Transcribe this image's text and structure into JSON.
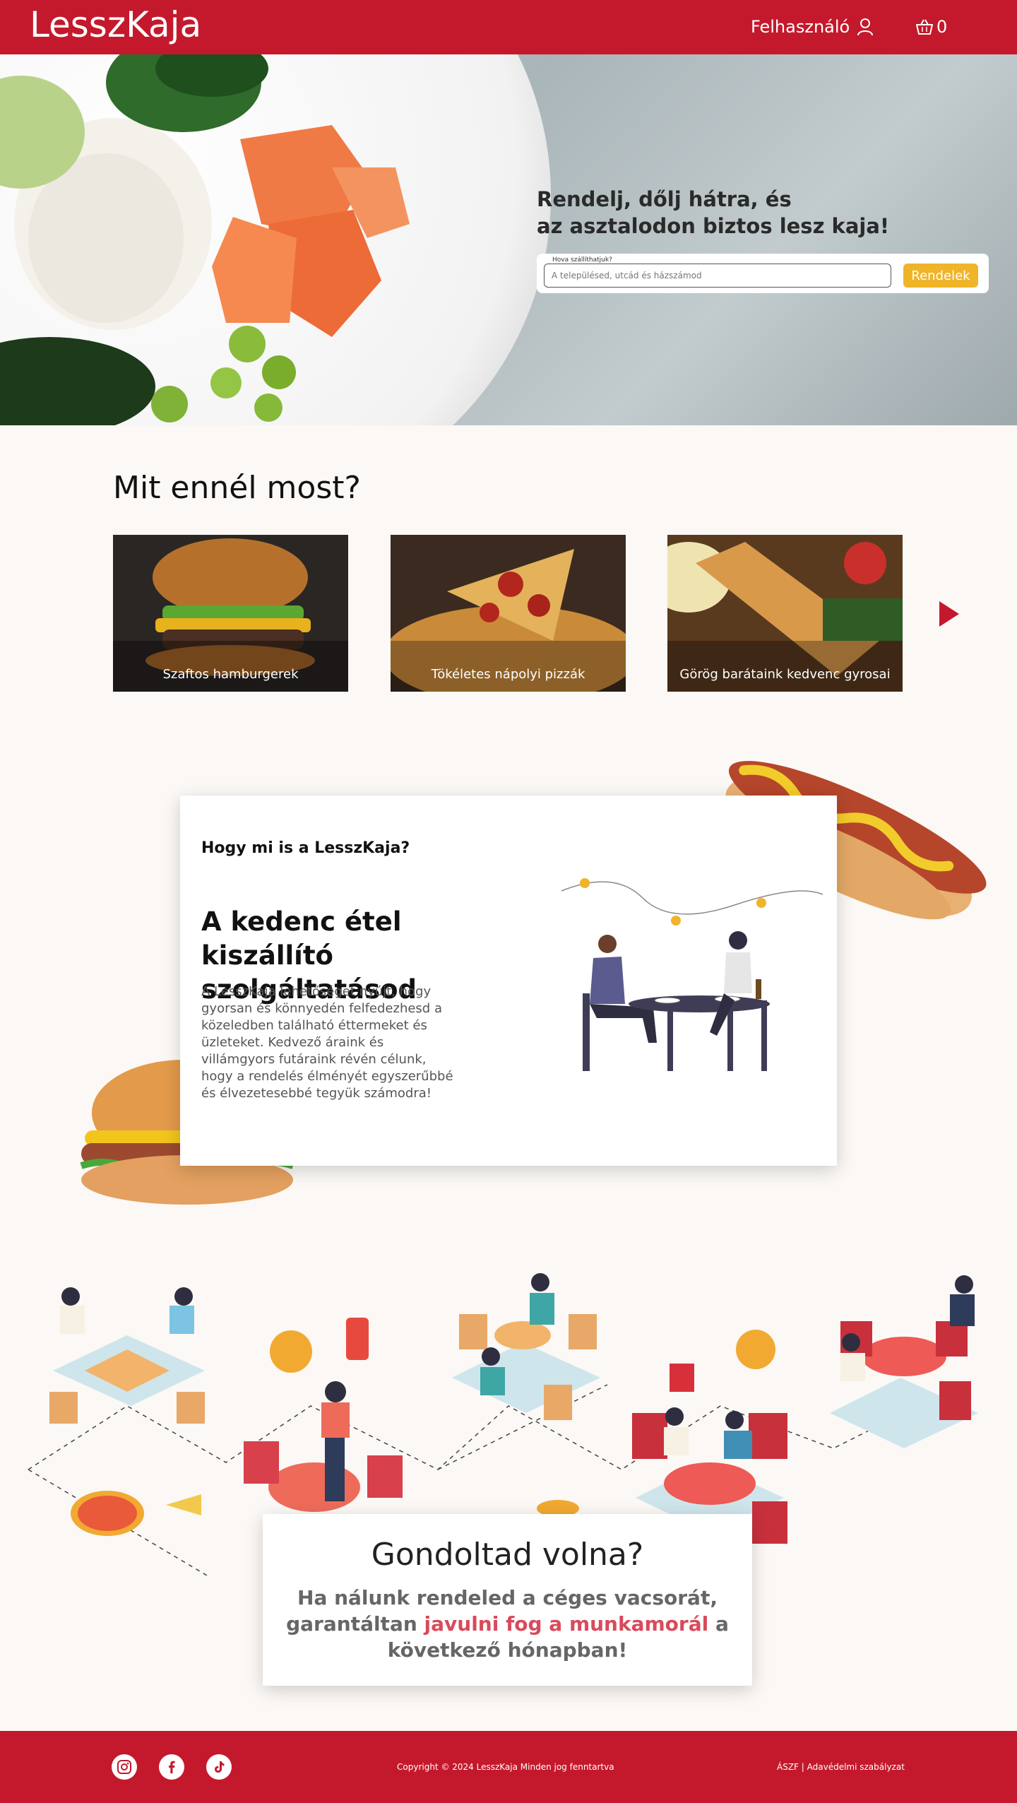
{
  "header": {
    "logo": "LesszKaja",
    "user_label": "Felhasználó",
    "cart_count": "0"
  },
  "hero": {
    "headline_line1": "Rendelj, dőlj hátra, és",
    "headline_line2": "az asztalodon biztos lesz kaja!",
    "search_label": "Hova szállíthatjuk?",
    "search_placeholder": "A településed, utcád és házszámod",
    "order_button": "Rendelek"
  },
  "categories": {
    "title": "Mit ennél most?",
    "items": [
      {
        "label": "Szaftos hamburgerek"
      },
      {
        "label": "Tökéletes nápolyi pizzák"
      },
      {
        "label": "Görög barátaink kedvenc gyrosai"
      }
    ]
  },
  "about": {
    "small_title": "Hogy mi is a LesszKaja?",
    "big_title": "A kedenc étel kiszállító szolgáltatásod",
    "description": "A LesszKaja lehetőséget nyújt, hogy gyorsan és könnyedén felfedezhesd a közeledben található éttermeket és üzleteket. Kedvező áraink és villámgyors futáraink révén célunk, hogy a rendelés élményét egyszerűbbé és élvezetesebbé tegyük számodra!"
  },
  "know": {
    "title": "Gondoltad volna?",
    "text_part1": "Ha nálunk rendeled a céges vacsorát, garantáltan ",
    "highlight": "javulni fog a munkamorál",
    "text_part2": " a következő hónapban!"
  },
  "footer": {
    "copyright": "Copyright © 2024 LesszKaja Minden jog fenntartva",
    "links": "ÁSZF | Adavédelmi szabályzat"
  },
  "colors": {
    "brand": "#c4192c",
    "accent": "#f0b429",
    "highlight": "#d94a5c"
  },
  "icons": [
    "user-icon",
    "cart-icon",
    "instagram-icon",
    "facebook-icon",
    "tiktok-icon",
    "chevron-right-icon"
  ]
}
